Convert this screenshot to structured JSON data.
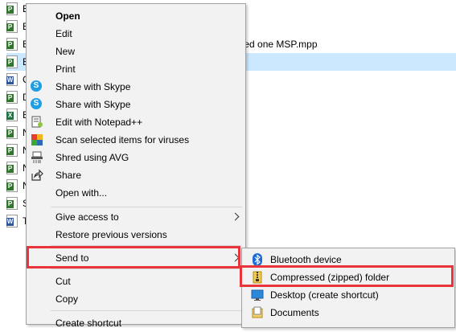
{
  "files": [
    {
      "name": "B",
      "type": "project",
      "selected": false
    },
    {
      "name": "B",
      "type": "project",
      "selected": false
    },
    {
      "name": "B",
      "type": "project",
      "selected": false,
      "tail": "ted one MSP.mpp"
    },
    {
      "name": "B",
      "type": "project",
      "selected": true
    },
    {
      "name": "C",
      "type": "word",
      "selected": false
    },
    {
      "name": "D",
      "type": "project",
      "selected": false
    },
    {
      "name": "E",
      "type": "excel",
      "selected": false
    },
    {
      "name": "N",
      "type": "project",
      "selected": false
    },
    {
      "name": "N",
      "type": "project",
      "selected": false
    },
    {
      "name": "N",
      "type": "project",
      "selected": false
    },
    {
      "name": "N",
      "type": "project",
      "selected": false
    },
    {
      "name": "S",
      "type": "project",
      "selected": false
    },
    {
      "name": "T",
      "type": "word",
      "selected": false
    }
  ],
  "menu": {
    "open": "Open",
    "edit": "Edit",
    "new": "New",
    "print": "Print",
    "share_skype_1": "Share with Skype",
    "share_skype_2": "Share with Skype",
    "edit_notepad": "Edit with Notepad++",
    "scan_viruses": "Scan selected items for viruses",
    "shred_avg": "Shred using AVG",
    "share": "Share",
    "open_with": "Open with...",
    "give_access": "Give access to",
    "restore_versions": "Restore previous versions",
    "send_to": "Send to",
    "cut": "Cut",
    "copy": "Copy",
    "create_shortcut": "Create shortcut"
  },
  "submenu": {
    "bluetooth": "Bluetooth device",
    "compressed": "Compressed (zipped) folder",
    "desktop": "Desktop (create shortcut)",
    "documents": "Documents"
  },
  "colors": {
    "highlight": "#e8343a",
    "selection": "#cce8ff",
    "project": "#31752f",
    "word": "#2b579a",
    "excel": "#217346"
  }
}
